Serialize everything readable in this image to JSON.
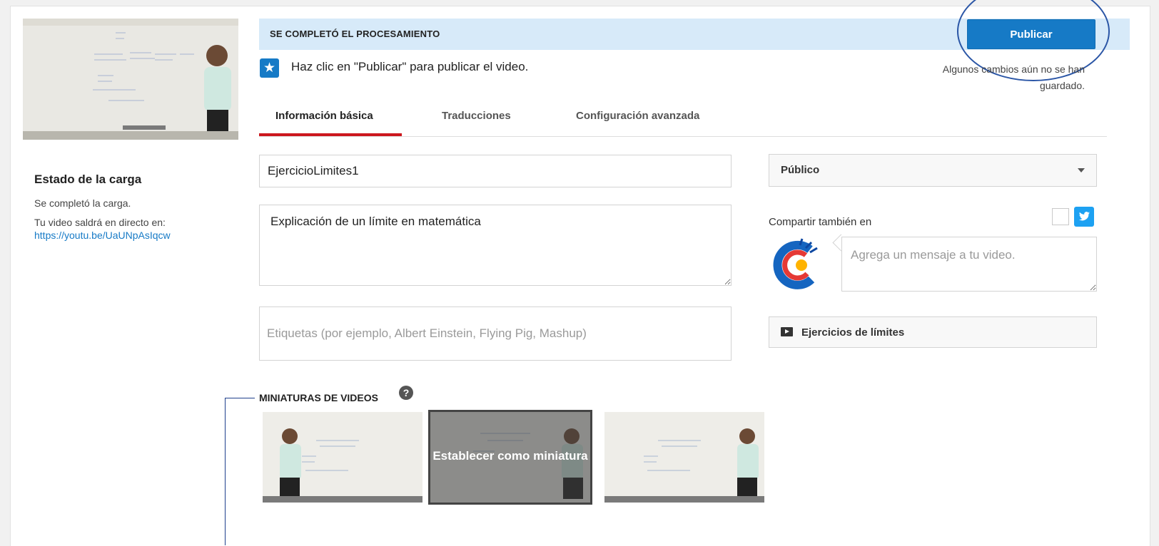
{
  "upload_status": {
    "title": "Estado de la carga",
    "completed": "Se completó la carga.",
    "live_label": "Tu video saldrá en directo en:",
    "url": "https://youtu.be/UaUNpAsIqcw"
  },
  "banner": {
    "title": "SE COMPLETÓ EL PROCESAMIENTO",
    "hint": "Haz clic en \"Publicar\" para publicar el video.",
    "publish_label": "Publicar",
    "unsaved_line1": "Algunos cambios aún no se han",
    "unsaved_line2": "guardado."
  },
  "tabs": [
    {
      "label": "Información básica",
      "active": true
    },
    {
      "label": "Traducciones",
      "active": false
    },
    {
      "label": "Configuración avanzada",
      "active": false
    }
  ],
  "form": {
    "title_value": "EjercicioLimites1",
    "description_value": "Explicación de un límite en matemática",
    "tags_placeholder": "Etiquetas (por ejemplo, Albert Einstein, Flying Pig, Mashup)",
    "privacy_value": "Público",
    "share_label": "Compartir también en",
    "share_placeholder": "Agrega un mensaje a tu video.",
    "playlist_label": "Ejercicios de límites"
  },
  "thumbnails": {
    "title": "MINIATURAS DE VIDEOS",
    "help": "?",
    "set_label": "Establecer como miniatura"
  },
  "colors": {
    "accent": "#167ac6",
    "banner_bg": "#d7eaf9",
    "tab_underline": "#cc181e",
    "annotation": "#2b56a6",
    "twitter": "#1da1f2"
  }
}
